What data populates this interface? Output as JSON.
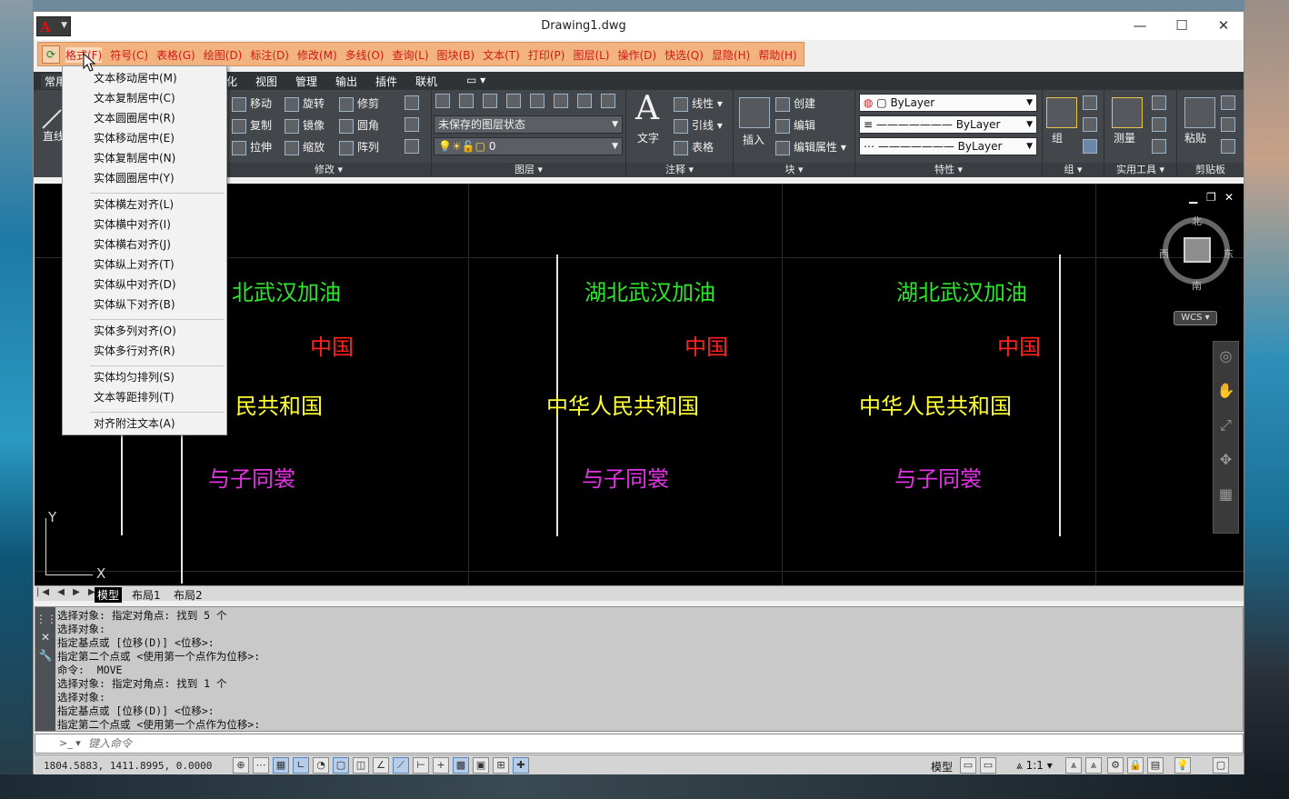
{
  "window": {
    "title": "Drawing1.dwg",
    "app_icon": "A",
    "minimize": "—",
    "maximize": "☐",
    "close": "✕"
  },
  "menubar": {
    "logo": "⟳",
    "items": [
      "格式(F)",
      "符号(C)",
      "表格(G)",
      "绘图(D)",
      "标注(D)",
      "修改(M)",
      "多线(O)",
      "查询(L)",
      "图块(B)",
      "文本(T)",
      "打印(P)",
      "图层(L)",
      "操作(D)",
      "快选(Q)",
      "显隐(H)",
      "帮助(H)"
    ],
    "active_index": 0
  },
  "tabs": {
    "t0": "常用",
    "t1": "化",
    "t2": "视图",
    "t3": "管理",
    "t4": "输出",
    "t5": "插件",
    "t6": "联机",
    "t7": "▭ ▾"
  },
  "ribbon": {
    "draw": {
      "line": "直线"
    },
    "modify": {
      "title": "修改 ▾",
      "move": "移动",
      "rotate": "旋转",
      "trim": "修剪",
      "copy": "复制",
      "mirror": "镜像",
      "fillet": "圆角",
      "stretch": "拉伸",
      "scale": "缩放",
      "array": "阵列"
    },
    "layers": {
      "title": "图层 ▾",
      "state": "未保存的图层状态",
      "layer": "0"
    },
    "annotation": {
      "title": "注释 ▾",
      "text": "文字",
      "linear": "线性",
      "leader": "引线",
      "table": "表格"
    },
    "block": {
      "title": "块 ▾",
      "insert": "插入",
      "create": "创建",
      "edit": "编辑",
      "edit_attr": "编辑属性"
    },
    "properties": {
      "title": "特性 ▾",
      "color": "ByLayer",
      "linetype": "ByLayer",
      "lineweight": "ByLayer"
    },
    "groups": {
      "title": "组 ▾",
      "group": "组"
    },
    "utilities": {
      "title": "实用工具 ▾",
      "measure": "测量"
    },
    "clipboard": {
      "title": "剪贴板",
      "paste": "粘贴"
    }
  },
  "context_menu": {
    "group1": [
      "文本移动居中(M)",
      "文本复制居中(C)",
      "文本圆圈居中(R)",
      "实体移动居中(E)",
      "实体复制居中(N)",
      "实体圆圈居中(Y)"
    ],
    "group2": [
      "实体横左对齐(L)",
      "实体横中对齐(I)",
      "实体横右对齐(J)",
      "实体纵上对齐(T)",
      "实体纵中对齐(D)",
      "实体纵下对齐(B)"
    ],
    "group3": [
      "实体多列对齐(O)",
      "实体多行对齐(R)"
    ],
    "group4": [
      "实体均匀排列(S)",
      "文本等距排列(T)"
    ],
    "group5": [
      "对齐附注文本(A)"
    ]
  },
  "drawing": {
    "view_controls": {
      "min": "▁",
      "restore": "❐",
      "close": "✕"
    },
    "compass": {
      "north": "北",
      "south": "南",
      "east": "东",
      "west": "西"
    },
    "wcs": "WCS ▾",
    "ucs": {
      "x": "X",
      "y": "Y"
    },
    "col1": {
      "line1": "北武汉加油",
      "line2": "中国",
      "line3": "民共和国",
      "line4": "与子同裳"
    },
    "col2": {
      "line1": "湖北武汉加油",
      "line2": "中国",
      "line3": "中华人民共和国",
      "line4": "与子同裳"
    },
    "col3": {
      "line1": "湖北武汉加油",
      "line2": "中国",
      "line3": "中华人民共和国",
      "line4": "与子同裳"
    },
    "colors": {
      "green": "#2ee62e",
      "red": "#ff2020",
      "yellow": "#ffff33",
      "magenta": "#e632e6"
    }
  },
  "layout_tabs": {
    "nav": "|◀ ◀ ▶ ▶|",
    "model": "模型",
    "layout1": "布局1",
    "layout2": "布局2"
  },
  "command": {
    "lines": [
      "选择对象: 指定对角点: 找到 5 个",
      "选择对象:",
      "指定基点或 [位移(D)] <位移>:",
      "指定第二个点或 <使用第一个点作为位移>:",
      "命令:  MOVE",
      "选择对象: 指定对角点: 找到 1 个",
      "选择对象:",
      "指定基点或 [位移(D)] <位移>:",
      "指定第二个点或 <使用第一个点作为位移>:"
    ],
    "input_placeholder": "键入命令",
    "prompt_icon": ">_ ▾"
  },
  "statusbar": {
    "coords": "1804.5883, 1411.8995, 0.0000",
    "model": "模型",
    "scale": "1:1 ▾"
  }
}
